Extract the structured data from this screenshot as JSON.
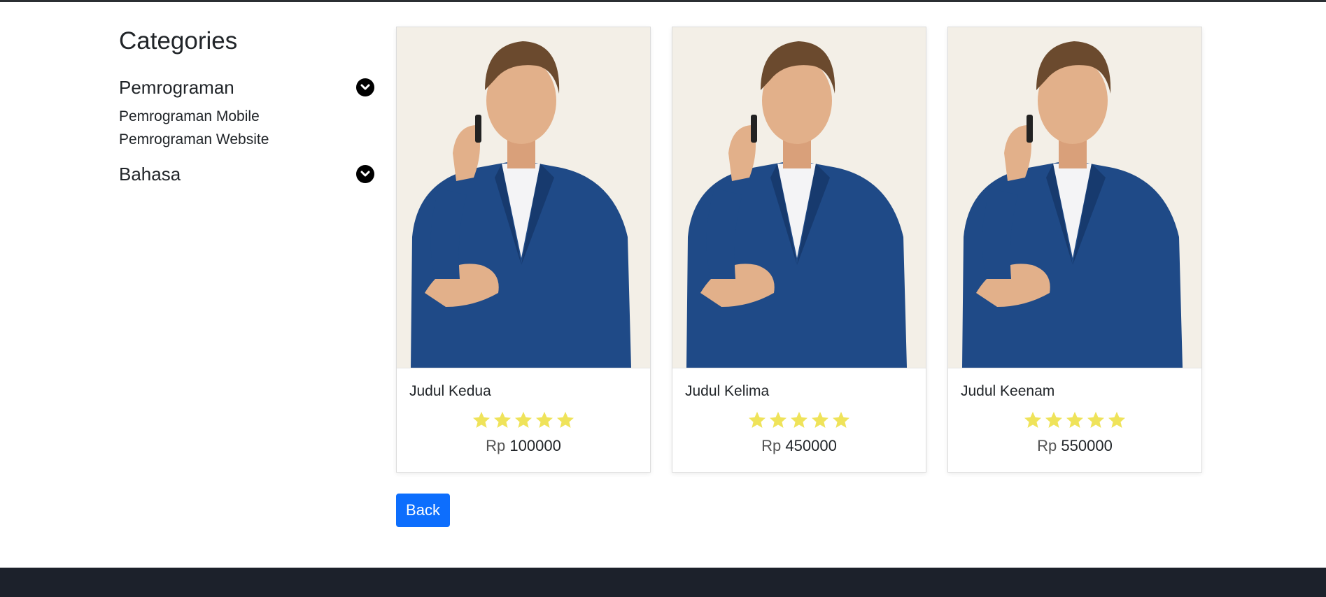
{
  "sidebar": {
    "title": "Categories",
    "groups": [
      {
        "name": "Pemrograman",
        "items": [
          "Pemrograman Mobile",
          "Pemrograman Website"
        ]
      },
      {
        "name": "Bahasa",
        "items": []
      }
    ]
  },
  "products": [
    {
      "title": "Judul Kedua",
      "currency": "Rp",
      "price": "100000",
      "rating": 5
    },
    {
      "title": "Judul Kelima",
      "currency": "Rp",
      "price": "450000",
      "rating": 5
    },
    {
      "title": "Judul Keenam",
      "currency": "Rp",
      "price": "550000",
      "rating": 5
    }
  ],
  "actions": {
    "back_label": "Back"
  },
  "colors": {
    "accent": "#0d6efd",
    "star": "#efe35a",
    "footer": "#1c212b",
    "image_bg": "#f3efe7",
    "suit": "#1f4a87"
  },
  "icons": {
    "chevron": "chevron-down-circle-icon",
    "star": "star-icon",
    "image": "man-on-phone-photo"
  }
}
